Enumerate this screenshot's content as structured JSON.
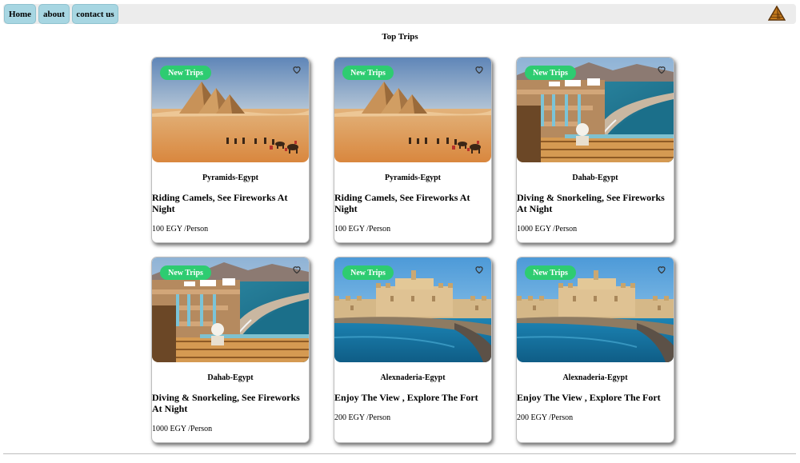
{
  "nav": {
    "home_label": "Home",
    "about_label": "about",
    "contact_label": "contact us",
    "logo_icon": "pyramid-logo-icon"
  },
  "section_title": "Top Trips",
  "colors": {
    "nav_button": "#a7d6e2",
    "badge": "#2ecc71",
    "nav_bar": "#ececec"
  },
  "cards": [
    {
      "badge": "New Trips",
      "location": "Pyramids-Egypt",
      "title": "Riding Camels, See Fireworks At Night",
      "price": "100 EGY /Person",
      "image": "pyramids"
    },
    {
      "badge": "New Trips",
      "location": "Pyramids-Egypt",
      "title": "Riding Camels, See Fireworks At Night",
      "price": "100 EGY /Person",
      "image": "pyramids"
    },
    {
      "badge": "New Trips",
      "location": "Dahab-Egypt",
      "title": "Diving & Snorkeling, See Fireworks At Night",
      "price": "1000 EGY /Person",
      "image": "dahab"
    },
    {
      "badge": "New Trips",
      "location": "Dahab-Egypt",
      "title": "Diving & Snorkeling, See Fireworks At Night",
      "price": "1000 EGY /Person",
      "image": "dahab"
    },
    {
      "badge": "New Trips",
      "location": "Alexnaderia-Egypt",
      "title": "Enjoy The View , Explore The Fort",
      "price": "200 EGY /Person",
      "image": "fort"
    },
    {
      "badge": "New Trips",
      "location": "Alexnaderia-Egypt",
      "title": "Enjoy The View , Explore The Fort",
      "price": "200 EGY /Person",
      "image": "fort"
    }
  ]
}
